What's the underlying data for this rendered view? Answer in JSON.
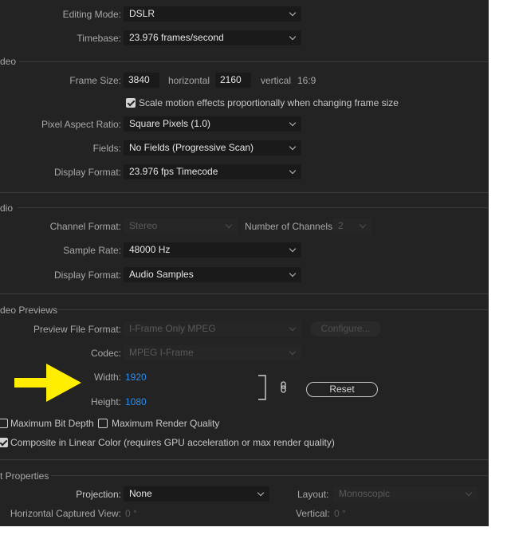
{
  "general": {
    "editing_mode_label": "Editing Mode:",
    "editing_mode_value": "DSLR",
    "timebase_label": "Timebase:",
    "timebase_value": "23.976  frames/second"
  },
  "video": {
    "section_title": "deo",
    "frame_size_label": "Frame Size:",
    "frame_width": "3840",
    "horizontal_label": "horizontal",
    "frame_height": "2160",
    "vertical_label": "vertical",
    "aspect": "16:9",
    "scale_motion_label": "Scale motion effects proportionally when changing frame size",
    "scale_motion_checked": true,
    "pixel_aspect_label": "Pixel Aspect Ratio:",
    "pixel_aspect_value": "Square Pixels (1.0)",
    "fields_label": "Fields:",
    "fields_value": "No Fields (Progressive Scan)",
    "display_format_label": "Display Format:",
    "display_format_value": "23.976 fps Timecode"
  },
  "audio": {
    "section_title": "dio",
    "channel_format_label": "Channel Format:",
    "channel_format_value": "Stereo",
    "num_channels_label": "Number of Channels:",
    "num_channels_value": "2",
    "sample_rate_label": "Sample Rate:",
    "sample_rate_value": "48000 Hz",
    "display_format_label": "Display Format:",
    "display_format_value": "Audio Samples"
  },
  "previews": {
    "section_title": "deo Previews",
    "preview_format_label": "Preview File Format:",
    "preview_format_value": "I-Frame Only MPEG",
    "configure_label": "Configure...",
    "codec_label": "Codec:",
    "codec_value": "MPEG I-Frame",
    "width_label": "Width:",
    "width_value": "1920",
    "height_label": "Height:",
    "height_value": "1080",
    "reset_label": "Reset",
    "max_bit_depth_label": "Maximum Bit Depth",
    "max_render_quality_label": "Maximum Render Quality",
    "linear_color_label": "Composite in Linear Color (requires GPU acceleration or max render quality)",
    "linear_color_checked": true
  },
  "vr": {
    "section_title": "t Properties",
    "projection_label": "Projection:",
    "projection_value": "None",
    "layout_label": "Layout:",
    "layout_value": "Monoscopic",
    "horizontal_view_label": "Horizontal Captured View:",
    "horizontal_view_value": "0 °",
    "vertical_label": "Vertical:",
    "vertical_value": "0 °"
  },
  "colors": {
    "panel_bg": "#232323",
    "accent_blue": "#2d8ceb",
    "arrow_yellow": "#ffee00"
  }
}
